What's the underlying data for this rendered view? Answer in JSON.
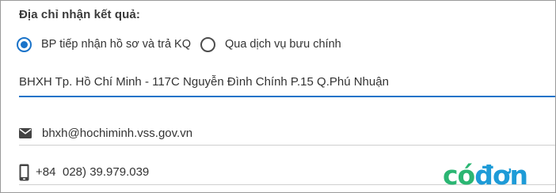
{
  "heading": "Địa chỉ nhận kết quả:",
  "receive_options": [
    {
      "label": "BP tiếp nhận hồ sơ và trả KQ",
      "selected": true
    },
    {
      "label": "Qua dịch vụ bưu chính",
      "selected": false
    }
  ],
  "address": {
    "value": "BHXH Tp. Hồ Chí Minh - 117C Nguyễn Đình Chính P.15 Q.Phú Nhuận"
  },
  "email": {
    "icon": "mail-icon",
    "value": "bhxh@hochiminh.vss.gov.vn"
  },
  "phone": {
    "icon": "smartphone-icon",
    "country_code": "+84",
    "value": "028) 39.979.039"
  },
  "watermark": {
    "part1": "có",
    "part2": "đơn",
    "color1": "#2bb673",
    "color2": "#1e9bd7"
  },
  "colors": {
    "accent": "#1a73c9",
    "text": "#333333",
    "divider": "#cfcfcf"
  }
}
